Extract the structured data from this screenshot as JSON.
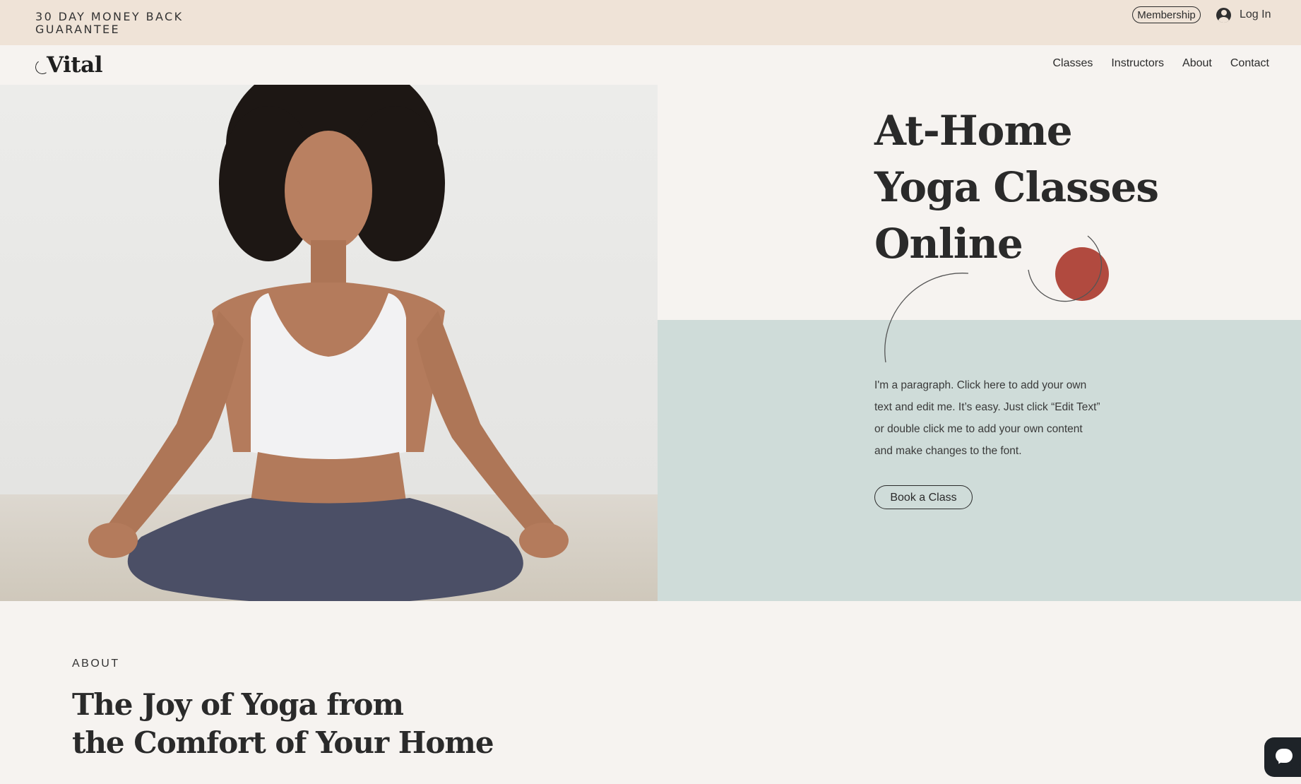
{
  "topbar": {
    "promo_text": "30 DAY MONEY BACK GUARANTEE",
    "membership_label": "Membership",
    "login_label": "Log In"
  },
  "header": {
    "logo_text": "Vital",
    "nav": [
      "Classes",
      "Instructors",
      "About",
      "Contact"
    ]
  },
  "hero": {
    "title_lines": [
      "At-Home",
      "Yoga Classes",
      "Online"
    ],
    "paragraph": "I'm a paragraph. Click here to add your own text and edit me. It’s easy. Just click “Edit Text” or double click me to add your own content and make changes to the font.",
    "cta_label": "Book a Class"
  },
  "about": {
    "eyebrow": "ABOUT",
    "heading_lines": [
      "The Joy of Yoga from",
      "the Comfort of Your Home"
    ]
  },
  "colors": {
    "topbar_bg": "#efe3d7",
    "page_bg": "#f6f3f0",
    "sage_panel": "#cfdcd9",
    "accent_circle": "#b14a3f",
    "text": "#2b2b2b"
  },
  "icons": {
    "login": "user-avatar-icon",
    "chat": "chat-bubble-icon",
    "logo": "crescent-icon"
  }
}
